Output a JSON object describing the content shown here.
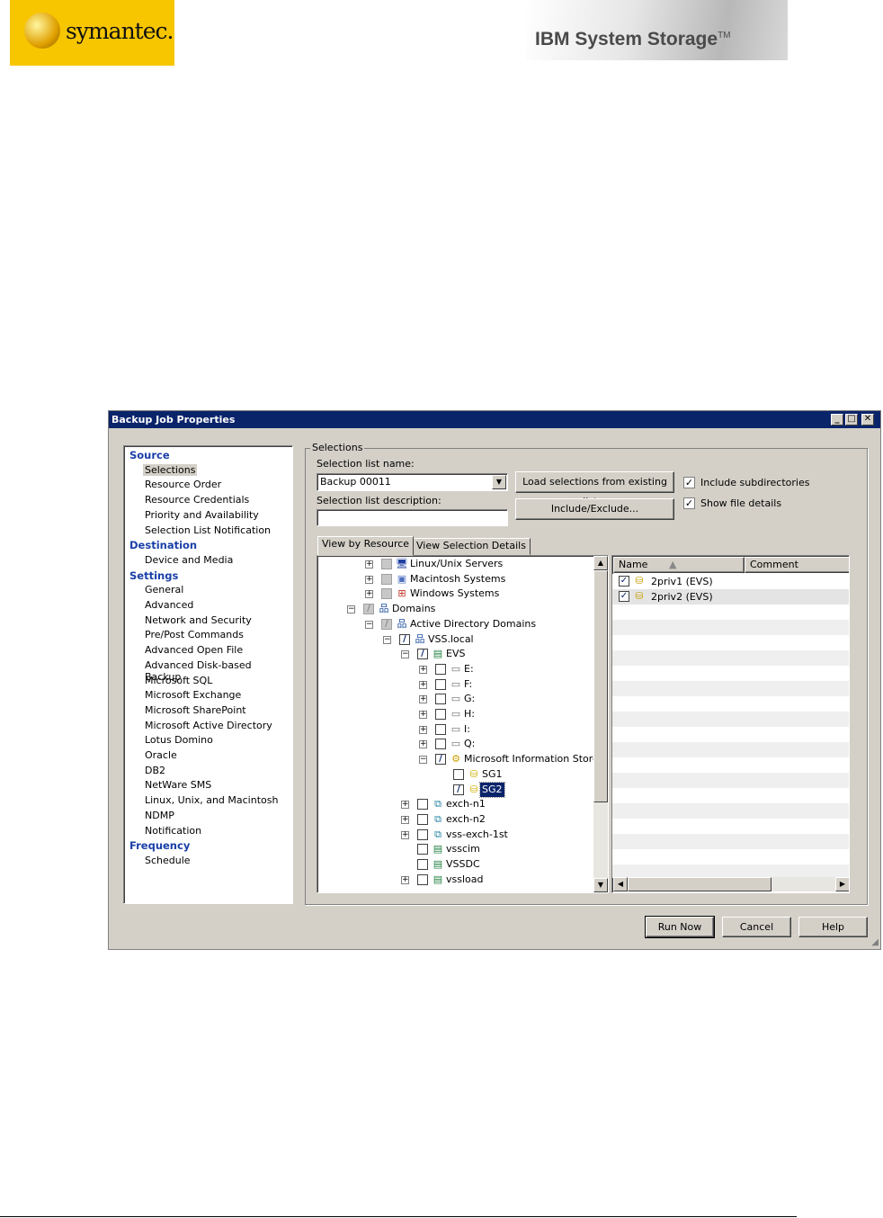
{
  "logos": {
    "symantec": "symantec.",
    "ibm": "IBM System Storage",
    "ibm_tm": "TM"
  },
  "dialog": {
    "title": "Backup Job Properties",
    "minimize": "_",
    "maximize": "□",
    "close": "✕"
  },
  "nav": [
    {
      "type": "header",
      "label": "Source"
    },
    {
      "type": "item",
      "label": "Selections",
      "selected": true
    },
    {
      "type": "item",
      "label": "Resource Order"
    },
    {
      "type": "item",
      "label": "Resource Credentials"
    },
    {
      "type": "item",
      "label": "Priority and Availability"
    },
    {
      "type": "item",
      "label": "Selection List Notification"
    },
    {
      "type": "header",
      "label": "Destination"
    },
    {
      "type": "item",
      "label": "Device and Media"
    },
    {
      "type": "header",
      "label": "Settings"
    },
    {
      "type": "item",
      "label": "General"
    },
    {
      "type": "item",
      "label": "Advanced"
    },
    {
      "type": "item",
      "label": "Network and Security"
    },
    {
      "type": "item",
      "label": "Pre/Post Commands"
    },
    {
      "type": "item",
      "label": "Advanced Open File"
    },
    {
      "type": "item",
      "label": "Advanced Disk-based Backup"
    },
    {
      "type": "item",
      "label": "Microsoft SQL"
    },
    {
      "type": "item",
      "label": "Microsoft Exchange"
    },
    {
      "type": "item",
      "label": "Microsoft SharePoint"
    },
    {
      "type": "item",
      "label": "Microsoft Active Directory"
    },
    {
      "type": "item",
      "label": "Lotus Domino"
    },
    {
      "type": "item",
      "label": "Oracle"
    },
    {
      "type": "item",
      "label": "DB2"
    },
    {
      "type": "item",
      "label": "NetWare SMS"
    },
    {
      "type": "item",
      "label": "Linux, Unix, and Macintosh"
    },
    {
      "type": "item",
      "label": "NDMP"
    },
    {
      "type": "item",
      "label": "Notification"
    },
    {
      "type": "header",
      "label": "Frequency"
    },
    {
      "type": "item",
      "label": "Schedule"
    }
  ],
  "selections": {
    "group_label": "Selections",
    "name_label": "Selection list name:",
    "name_value": "Backup 00011",
    "desc_label": "Selection list description:",
    "desc_value": "",
    "load_button": "Load selections from existing list...",
    "include_exclude_button": "Include/Exclude...",
    "include_subdirs": {
      "label": "Include subdirectories",
      "checked": true
    },
    "show_file_details": {
      "label": "Show file details",
      "checked": true
    },
    "tabs": [
      "View by Resource",
      "View Selection Details"
    ]
  },
  "tree": [
    {
      "label": "Linux/Unix Servers",
      "level": 2,
      "exp": "plus",
      "check": "gray",
      "icon": "monitor"
    },
    {
      "label": "Macintosh Systems",
      "level": 2,
      "exp": "plus",
      "check": "gray",
      "icon": "mac"
    },
    {
      "label": "Windows Systems",
      "level": 2,
      "exp": "plus",
      "check": "gray",
      "icon": "windows"
    },
    {
      "label": "Domains",
      "level": 1,
      "exp": "minus",
      "check": "partial-gray",
      "icon": "network"
    },
    {
      "label": "Active Directory Domains",
      "level": 2,
      "exp": "minus",
      "check": "partial-gray",
      "icon": "network"
    },
    {
      "label": "VSS.local",
      "level": 3,
      "exp": "minus",
      "check": "partial",
      "icon": "network"
    },
    {
      "label": "EVS",
      "level": 4,
      "exp": "minus",
      "check": "partial",
      "icon": "server"
    },
    {
      "label": "E:",
      "level": 5,
      "exp": "plus",
      "check": "empty",
      "icon": "drive"
    },
    {
      "label": "F:",
      "level": 5,
      "exp": "plus",
      "check": "empty",
      "icon": "drive"
    },
    {
      "label": "G:",
      "level": 5,
      "exp": "plus",
      "check": "empty",
      "icon": "drive"
    },
    {
      "label": "H:",
      "level": 5,
      "exp": "plus",
      "check": "empty",
      "icon": "drive"
    },
    {
      "label": "I:",
      "level": 5,
      "exp": "plus",
      "check": "empty",
      "icon": "drive"
    },
    {
      "label": "Q:",
      "level": 5,
      "exp": "plus",
      "check": "empty",
      "icon": "drive"
    },
    {
      "label": "Microsoft Information Store",
      "level": 5,
      "exp": "minus",
      "check": "partial",
      "icon": "exchange"
    },
    {
      "label": "SG1",
      "level": 6,
      "exp": "none",
      "check": "empty",
      "icon": "database"
    },
    {
      "label": "SG2",
      "level": 6,
      "exp": "none",
      "check": "partial",
      "icon": "database",
      "selected": true
    },
    {
      "label": "exch-n1",
      "level": 4,
      "exp": "plus",
      "check": "empty",
      "icon": "cluster"
    },
    {
      "label": "exch-n2",
      "level": 4,
      "exp": "plus",
      "check": "empty",
      "icon": "cluster"
    },
    {
      "label": "vss-exch-1st",
      "level": 4,
      "exp": "plus",
      "check": "empty",
      "icon": "cluster"
    },
    {
      "label": "vsscim",
      "level": 4,
      "exp": "none",
      "check": "empty",
      "icon": "server"
    },
    {
      "label": "VSSDC",
      "level": 4,
      "exp": "none",
      "check": "empty",
      "icon": "server"
    },
    {
      "label": "vssload",
      "level": 4,
      "exp": "plus",
      "check": "empty",
      "icon": "server"
    }
  ],
  "details": {
    "columns": [
      "Name",
      "Comment"
    ],
    "rows": [
      {
        "name": "2priv1 (EVS)",
        "comment": "",
        "checked": true
      },
      {
        "name": "2priv2 (EVS)",
        "comment": "",
        "checked": true
      }
    ]
  },
  "footer": {
    "run_now": "Run Now",
    "cancel": "Cancel",
    "help": "Help"
  }
}
